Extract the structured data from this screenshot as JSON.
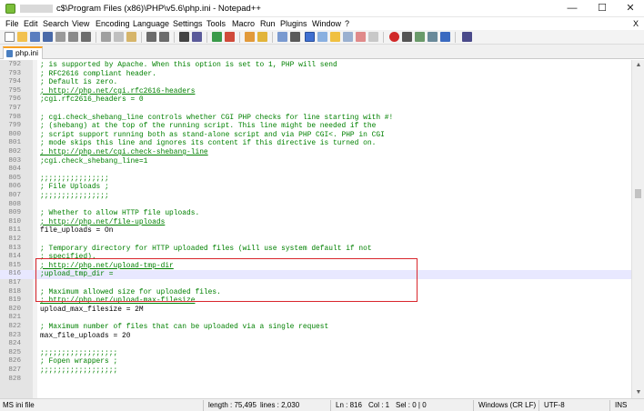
{
  "window": {
    "title": "c$\\Program Files (x86)\\PHP\\v5.6\\php.ini - Notepad++",
    "minimize_glyph": "—",
    "maximize_glyph": "☐",
    "close_glyph": "✕"
  },
  "menu": [
    "File",
    "Edit",
    "Search",
    "View",
    "Encoding",
    "Language",
    "Settings",
    "Tools",
    "Macro",
    "Run",
    "Plugins",
    "Window",
    "?"
  ],
  "menu_close": "X",
  "tab": {
    "label": "php.ini"
  },
  "lines": [
    {
      "n": "792",
      "text": "; is supported by Apache. When this option is set to 1, PHP will send",
      "kind": "comment"
    },
    {
      "n": "793",
      "text": "; RFC2616 compliant header.",
      "kind": "comment"
    },
    {
      "n": "794",
      "text": "; Default is zero.",
      "kind": "comment"
    },
    {
      "n": "795",
      "text": "; http://php.net/cgi.rfc2616-headers",
      "kind": "link"
    },
    {
      "n": "796",
      "text": ";cgi.rfc2616_headers = 0",
      "kind": "comment"
    },
    {
      "n": "797",
      "text": "",
      "kind": "plain"
    },
    {
      "n": "798",
      "text": "; cgi.check_shebang_line controls whether CGI PHP checks for line starting with #!",
      "kind": "comment"
    },
    {
      "n": "799",
      "text": "; (shebang) at the top of the running script. This line might be needed if the",
      "kind": "comment"
    },
    {
      "n": "800",
      "text": "; script support running both as stand-alone script and via PHP CGI<. PHP in CGI",
      "kind": "comment"
    },
    {
      "n": "801",
      "text": "; mode skips this line and ignores its content if this directive is turned on.",
      "kind": "comment"
    },
    {
      "n": "802",
      "text": "; http://php.net/cgi.check-shebang-line",
      "kind": "link"
    },
    {
      "n": "803",
      "text": ";cgi.check_shebang_line=1",
      "kind": "comment"
    },
    {
      "n": "804",
      "text": "",
      "kind": "plain"
    },
    {
      "n": "805",
      "text": ";;;;;;;;;;;;;;;;",
      "kind": "comment"
    },
    {
      "n": "806",
      "text": "; File Uploads ;",
      "kind": "comment"
    },
    {
      "n": "807",
      "text": ";;;;;;;;;;;;;;;;",
      "kind": "comment"
    },
    {
      "n": "808",
      "text": "",
      "kind": "plain"
    },
    {
      "n": "809",
      "text": "; Whether to allow HTTP file uploads.",
      "kind": "comment"
    },
    {
      "n": "810",
      "text": "; http://php.net/file-uploads",
      "kind": "link"
    },
    {
      "n": "811",
      "text": "file_uploads = On",
      "kind": "plain"
    },
    {
      "n": "812",
      "text": "",
      "kind": "plain"
    },
    {
      "n": "813",
      "text": "; Temporary directory for HTTP uploaded files (will use system default if not",
      "kind": "comment"
    },
    {
      "n": "814",
      "text": "; specified).",
      "kind": "comment"
    },
    {
      "n": "815",
      "text": "; http://php.net/upload-tmp-dir",
      "kind": "link"
    },
    {
      "n": "816",
      "text": ";upload_tmp_dir =",
      "kind": "comment",
      "current": true
    },
    {
      "n": "817",
      "text": "",
      "kind": "plain"
    },
    {
      "n": "818",
      "text": "; Maximum allowed size for uploaded files.",
      "kind": "comment"
    },
    {
      "n": "819",
      "text": "; http://php.net/upload-max-filesize",
      "kind": "link"
    },
    {
      "n": "820",
      "text": "upload_max_filesize = 2M",
      "kind": "plain"
    },
    {
      "n": "821",
      "text": "",
      "kind": "plain"
    },
    {
      "n": "822",
      "text": "; Maximum number of files that can be uploaded via a single request",
      "kind": "comment"
    },
    {
      "n": "823",
      "text": "max_file_uploads = 20",
      "kind": "plain"
    },
    {
      "n": "824",
      "text": "",
      "kind": "plain"
    },
    {
      "n": "825",
      "text": ";;;;;;;;;;;;;;;;;;",
      "kind": "comment"
    },
    {
      "n": "826",
      "text": "; Fopen wrappers ;",
      "kind": "comment"
    },
    {
      "n": "827",
      "text": ";;;;;;;;;;;;;;;;;;",
      "kind": "comment"
    },
    {
      "n": "828",
      "text": "",
      "kind": "plain"
    }
  ],
  "status": {
    "file_type": "MS ini file",
    "length": "length : 75,495",
    "lines": "lines : 2,030",
    "ln": "Ln : 816",
    "col": "Col : 1",
    "sel": "Sel : 0 | 0",
    "eol": "Windows (CR LF)",
    "encoding": "UTF-8",
    "mode": "INS"
  },
  "colors": {
    "comment": "#008000",
    "highlight_box": "#d9262c",
    "current_line": "#e8e8ff",
    "tab_accent": "#f9a020"
  }
}
